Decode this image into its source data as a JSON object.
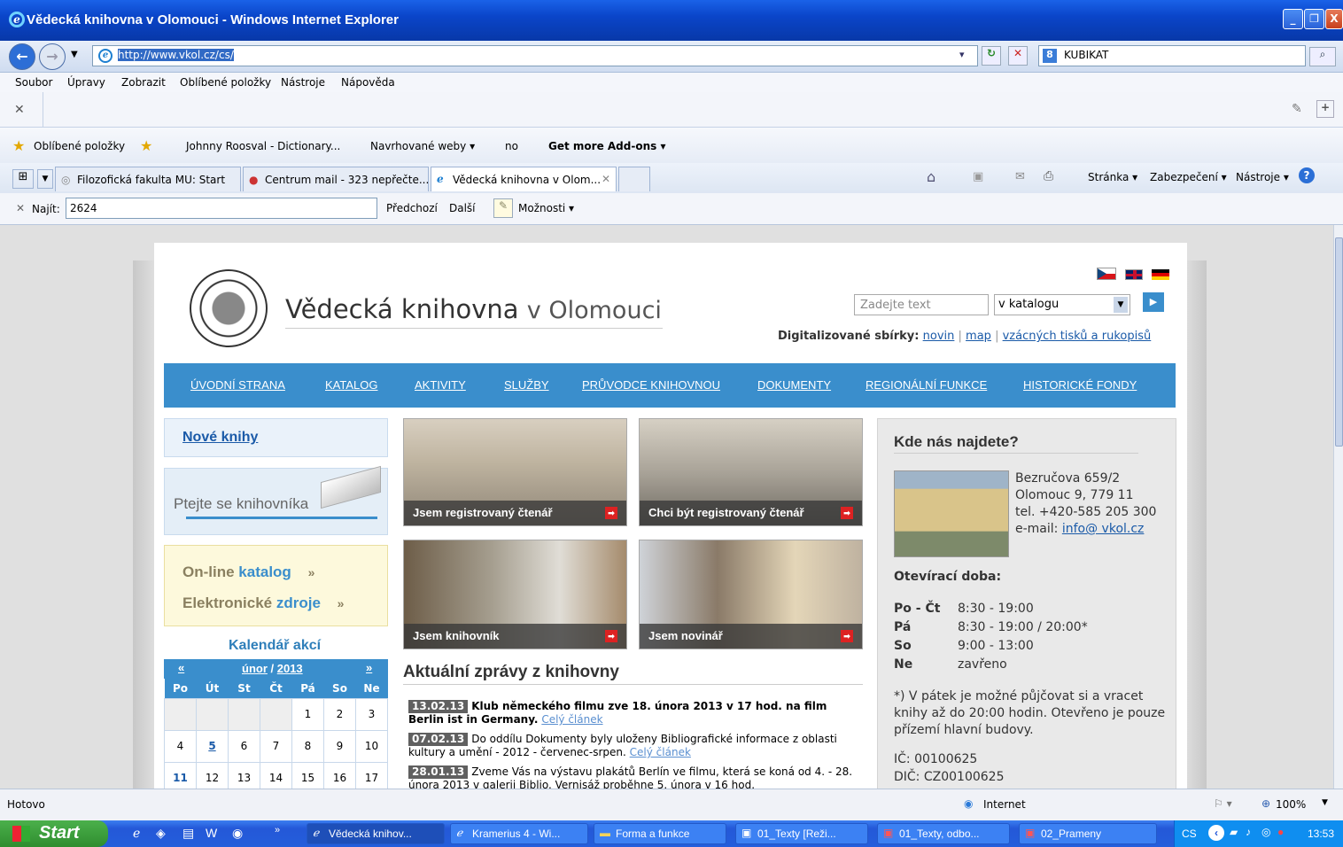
{
  "window": {
    "title": "Vědecká knihovna v Olomouci - Windows Internet Explorer",
    "min": "_",
    "max": "❐",
    "close": "X"
  },
  "address": {
    "url": "http://www.vkol.cz/cs/",
    "search_value": "KUBIKAT"
  },
  "menu": [
    "Soubor",
    "Úpravy",
    "Zobrazit",
    "Oblíbené položky",
    "Nástroje",
    "Nápověda"
  ],
  "favorites": {
    "label": "Oblíbené položky",
    "items": [
      "Johnny Roosval - Dictionary...",
      "Navrhované weby ▾",
      "no",
      "Get more Add-ons ▾"
    ]
  },
  "tabs": [
    "Filozofická fakulta MU: Start",
    "Centrum mail - 323 nepřečte...",
    "Vědecká knihovna v Olom..."
  ],
  "commandbar": [
    "Stránka ▾",
    "Zabezpečení ▾",
    "Nástroje ▾"
  ],
  "find": {
    "label": "Najít:",
    "value": "2624",
    "prev": "Předchozí",
    "next": "Další",
    "options": "Možnosti ▾"
  },
  "site": {
    "title_bold": "Vědecká knihovna",
    "title_light": "v Olomouci",
    "search_placeholder": "Zadejte text",
    "search_scope": "v katalogu",
    "digi_label": "Digitalizované sbírky:",
    "digi_links": [
      "novin",
      "map",
      "vzácných tisků a rukopisů"
    ],
    "nav": [
      "ÚVODNÍ STRANA",
      "KATALOG",
      "AKTIVITY",
      "SLUŽBY",
      "PRŮVODCE KNIHOVNOU",
      "DOKUMENTY",
      "REGIONÁLNÍ FUNKCE",
      "HISTORICKÉ FONDY"
    ],
    "new_books": "Nové knihy",
    "ask": "Ptejte se knihovníka",
    "online_a": "On-line",
    "online_b": "katalog",
    "el_a": "Elektronické",
    "el_b": "zdroje",
    "cal_title": "Kalendář akcí",
    "cal_month": "únor",
    "cal_year": "2013",
    "cal_days": [
      "Po",
      "Út",
      "St",
      "Čt",
      "Pá",
      "So",
      "Ne"
    ],
    "cal_weeks": [
      [
        "",
        "",
        "",
        "",
        "1",
        "2",
        "3"
      ],
      [
        "4",
        "5",
        "6",
        "7",
        "8",
        "9",
        "10"
      ],
      [
        "11",
        "12",
        "13",
        "14",
        "15",
        "16",
        "17"
      ]
    ],
    "photos": [
      "Jsem registrovaný čtenář",
      "Chci být registrovaný čtenář",
      "Jsem knihovník",
      "Jsem novinář"
    ],
    "news_title": "Aktuální zprávy z knihovny",
    "news": [
      {
        "date": "13.02.13",
        "text": "Klub německého filmu zve 18. února 2013 v 17 hod. na film Berlin ist in Germany.",
        "more": "Celý článek"
      },
      {
        "date": "07.02.13",
        "text": "Do oddílu Dokumenty byly uloženy Bibliografické informace z oblasti kultury a umění - 2012 - červenec-srpen.",
        "more": "Celý článek"
      },
      {
        "date": "28.01.13",
        "text": "Zveme Vás na výstavu plakátů Berlín ve filmu, která se koná od 4. - 28. února 2013 v galerii Biblio. Vernisáž proběhne 5. února v 16 hod.",
        "more": ""
      }
    ],
    "where_title": "Kde nás najdete?",
    "address_lines": [
      "Bezručova 659/2",
      "Olomouc 9, 779 11",
      "tel.  +420-585 205 300"
    ],
    "email_label": "e-mail:",
    "email": "info@ vkol.cz",
    "hours_title": "Otevírací doba:",
    "hours": [
      [
        "Po - Čt",
        "8:30 - 19:00"
      ],
      [
        "Pá",
        "8:30 - 19:00 / 20:00*"
      ],
      [
        "So",
        "9:00 - 13:00"
      ],
      [
        "Ne",
        "zavřeno"
      ]
    ],
    "note": "*) V pátek je možné půjčovat si a vracet knihy až do 20:00 hodin. Otevřeno je pouze přízemí hlavní budovy.",
    "ic": "IČ: 00100625",
    "dic": "DIČ: CZ00100625"
  },
  "status": {
    "left": "Hotovo",
    "zone": "Internet",
    "zoom": "100%"
  },
  "taskbar": {
    "start": "Start",
    "buttons": [
      "Vědecká knihov...",
      "Kramerius 4 - Wi...",
      "Forma a funkce",
      "01_Texty [Reži...",
      "01_Texty, odbo...",
      "02_Prameny"
    ],
    "lang": "CS",
    "clock": "13:53"
  }
}
